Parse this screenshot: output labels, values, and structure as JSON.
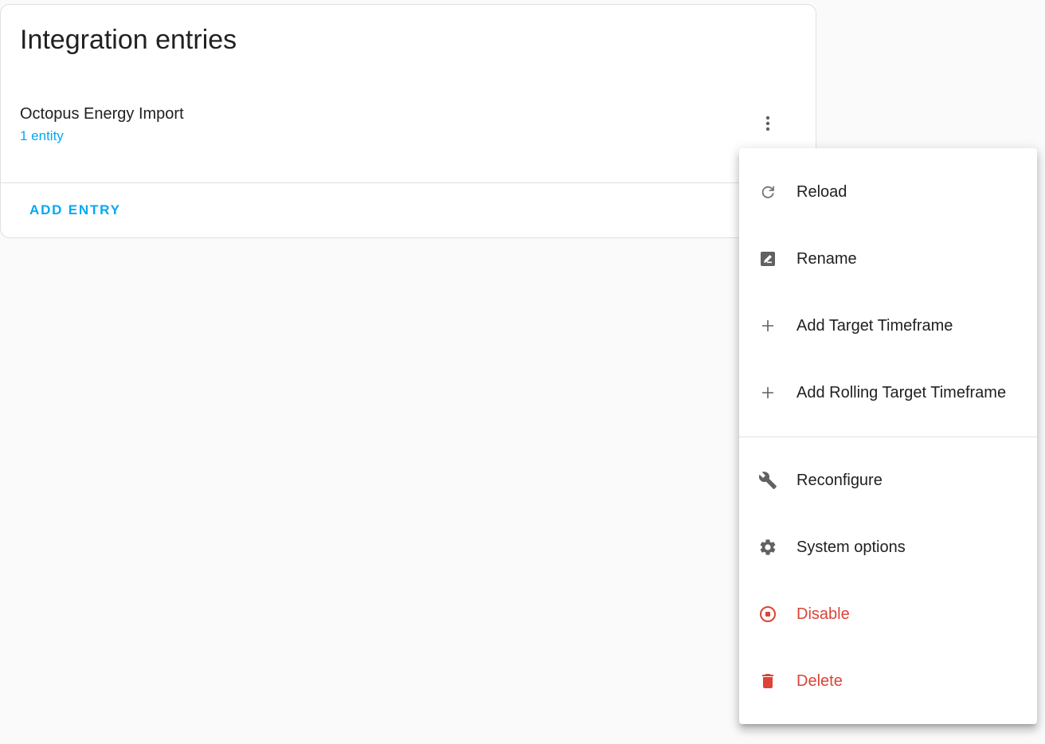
{
  "card": {
    "title": "Integration entries",
    "entry": {
      "name": "Octopus Energy Import",
      "entities_link": "1 entity"
    },
    "add_entry_label": "ADD ENTRY"
  },
  "menu": {
    "group1": [
      {
        "label": "Reload",
        "icon": "reload-icon"
      },
      {
        "label": "Rename",
        "icon": "rename-icon"
      },
      {
        "label": "Add Target Timeframe",
        "icon": "plus-icon"
      },
      {
        "label": "Add Rolling Target Timeframe",
        "icon": "plus-icon"
      }
    ],
    "group2": [
      {
        "label": "Reconfigure",
        "icon": "wrench-icon"
      },
      {
        "label": "System options",
        "icon": "gear-icon"
      },
      {
        "label": "Disable",
        "icon": "stop-circle-icon",
        "danger": true
      },
      {
        "label": "Delete",
        "icon": "trash-icon",
        "danger": true
      }
    ]
  },
  "colors": {
    "accent": "#03a9f4",
    "danger": "#db4437",
    "icon": "#757575",
    "background": "#fafafa"
  }
}
